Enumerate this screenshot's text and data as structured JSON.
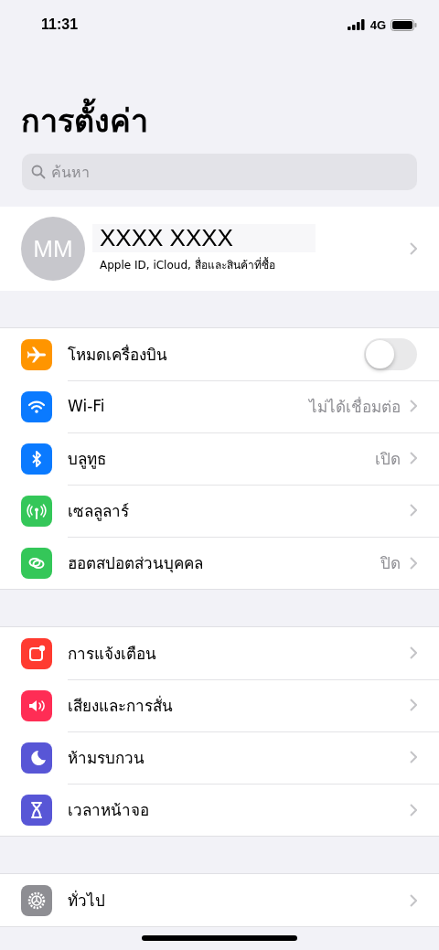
{
  "status_bar": {
    "time": "11:31",
    "network": "4G"
  },
  "title": "การตั้งค่า",
  "search": {
    "placeholder": "ค้นหา"
  },
  "profile": {
    "initials": "MM",
    "name": "XXXX XXXX",
    "subtitle": "Apple ID, iCloud, สื่อและสินค้าที่ซื้อ"
  },
  "groups": [
    [
      {
        "label": "โหมดเครื่องบิน",
        "kind": "toggle",
        "on": false,
        "color": "#ff9500"
      },
      {
        "label": "Wi-Fi",
        "kind": "link",
        "value": "ไม่ได้เชื่อมต่อ",
        "color": "#0a7aff"
      },
      {
        "label": "บลูทูธ",
        "kind": "link",
        "value": "เปิด",
        "color": "#0a7aff"
      },
      {
        "label": "เซลลูลาร์",
        "kind": "link",
        "color": "#34c759"
      },
      {
        "label": "ฮอตสปอตส่วนบุคคล",
        "kind": "link",
        "value": "ปิด",
        "color": "#34c759"
      }
    ],
    [
      {
        "label": "การแจ้งเตือน",
        "kind": "link",
        "color": "#ff3b30"
      },
      {
        "label": "เสียงและการสั่น",
        "kind": "link",
        "color": "#ff2d55"
      },
      {
        "label": "ห้ามรบกวน",
        "kind": "link",
        "color": "#5856d6"
      },
      {
        "label": "เวลาหน้าจอ",
        "kind": "link",
        "color": "#5856d6"
      }
    ],
    [
      {
        "label": "ทั่วไป",
        "kind": "link",
        "color": "#8e8e93"
      }
    ]
  ]
}
